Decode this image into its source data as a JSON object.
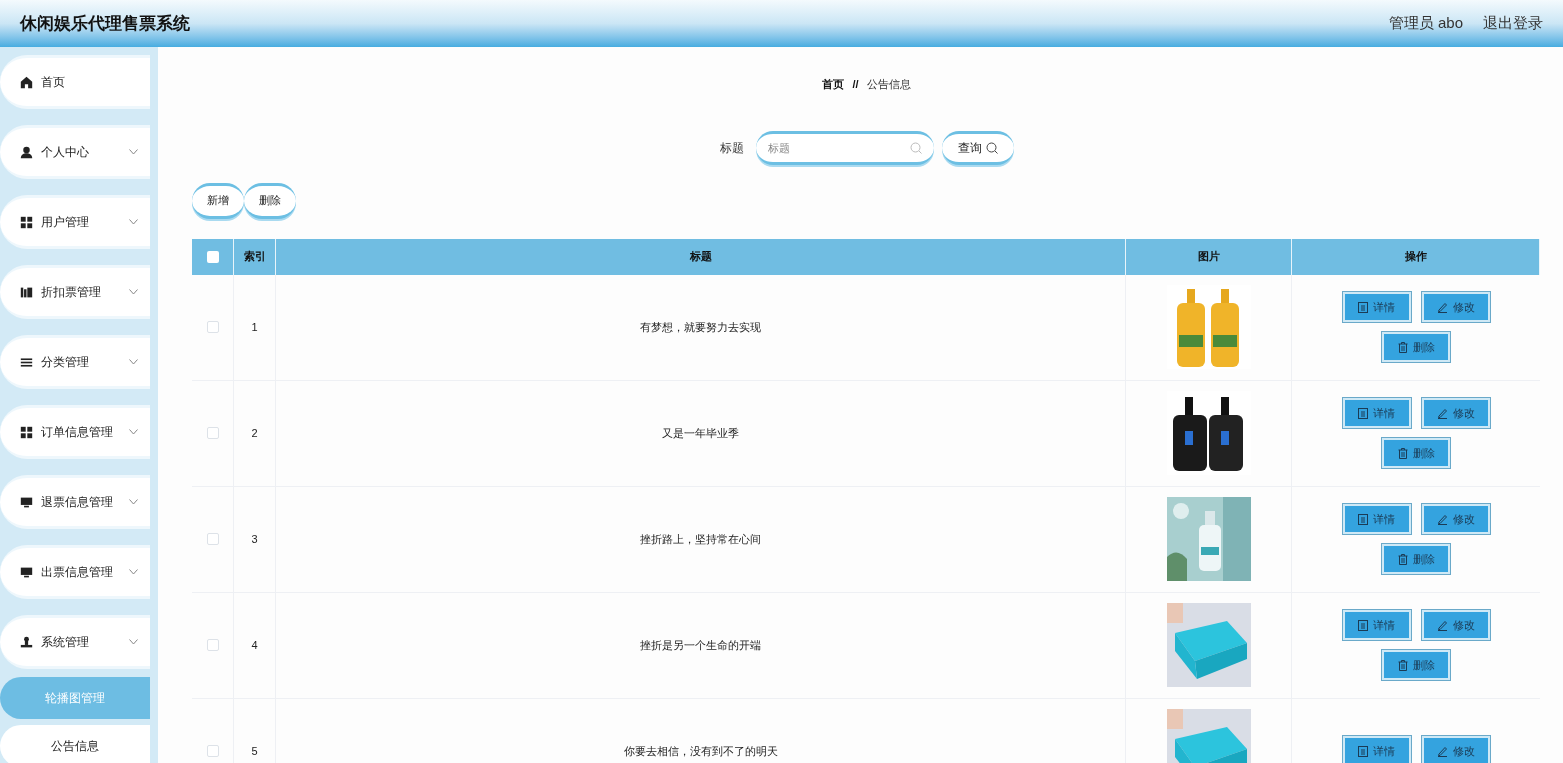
{
  "header": {
    "title": "休闲娱乐代理售票系统",
    "user": "管理员 abo",
    "logout": "退出登录"
  },
  "sidebar": {
    "items": [
      {
        "label": "首页",
        "submenu": false
      },
      {
        "label": "个人中心",
        "submenu": true
      },
      {
        "label": "用户管理",
        "submenu": true
      },
      {
        "label": "折扣票管理",
        "submenu": true
      },
      {
        "label": "分类管理",
        "submenu": true
      },
      {
        "label": "订单信息管理",
        "submenu": true
      },
      {
        "label": "退票信息管理",
        "submenu": true
      },
      {
        "label": "出票信息管理",
        "submenu": true
      },
      {
        "label": "系统管理",
        "submenu": true,
        "children": [
          {
            "label": "轮播图管理",
            "selected": true
          },
          {
            "label": "公告信息",
            "selected": false
          }
        ]
      }
    ]
  },
  "breadcrumb": [
    "首页",
    "//",
    "公告信息"
  ],
  "search": {
    "label": "标题",
    "placeholder": "标题",
    "button": "查询"
  },
  "toolbar": [
    "新增",
    "删除"
  ],
  "table": {
    "select_all": {
      "checked": false
    },
    "columns": [
      "索引",
      "标题",
      "图片",
      "操作"
    ],
    "rows": [
      {
        "checked": false,
        "index": "1",
        "title": "有梦想，就要努力去实现",
        "image": {
          "kind": "picture"
        },
        "actions": [
          "详情",
          "修改",
          "删除"
        ]
      },
      {
        "checked": false,
        "index": "2",
        "title": "又是一年毕业季",
        "image": {
          "kind": "picture"
        },
        "actions": [
          "详情",
          "修改",
          "删除"
        ]
      },
      {
        "checked": false,
        "index": "3",
        "title": "挫折路上，坚持常在心间",
        "image": {
          "kind": "picture"
        },
        "actions": [
          "详情",
          "修改",
          "删除"
        ]
      },
      {
        "checked": false,
        "index": "4",
        "title": "挫折是另一个生命的开端",
        "image": {
          "kind": "picture"
        },
        "actions": [
          "详情",
          "修改",
          "删除"
        ]
      },
      {
        "checked": false,
        "index": "5",
        "title": "你要去相信，没有到不了的明天",
        "image": {
          "kind": "picture"
        },
        "actions": [
          "详情",
          "修改"
        ]
      }
    ]
  }
}
